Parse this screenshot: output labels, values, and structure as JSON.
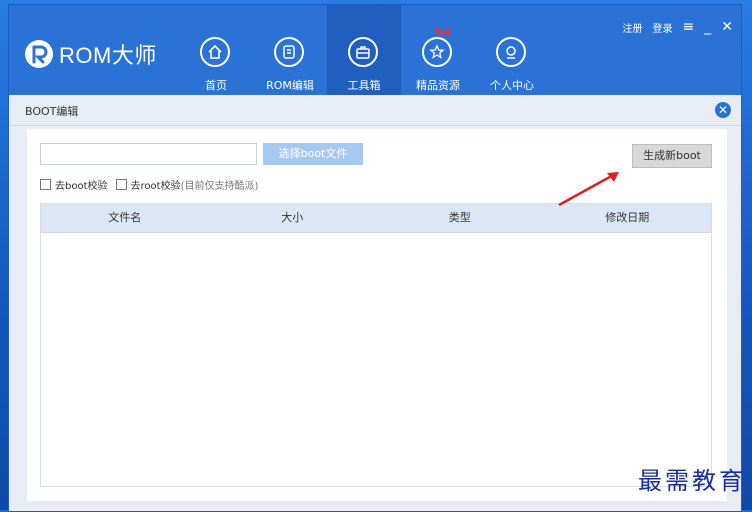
{
  "app": {
    "logo_text": "ROM大师"
  },
  "nav": [
    {
      "label": "首页",
      "icon": "home-icon"
    },
    {
      "label": "ROM编辑",
      "icon": "rom-edit-icon"
    },
    {
      "label": "工具箱",
      "icon": "toolbox-icon"
    },
    {
      "label": "精品资源",
      "icon": "star-icon",
      "badge": "hot"
    },
    {
      "label": "个人中心",
      "icon": "user-icon"
    }
  ],
  "window_controls": {
    "register": "注册",
    "login": "登录",
    "menu": "≡",
    "minimize": "_",
    "close": "✕"
  },
  "subbar": {
    "title": "BOOT编辑",
    "close": "✕"
  },
  "panel": {
    "path_value": "",
    "select_button": "选择boot文件",
    "generate_button": "生成新boot",
    "check_boot_label": "去boot校验",
    "check_root_label": "去root校验",
    "check_root_note": "(目前仅支持酷派)"
  },
  "table": {
    "columns": [
      "文件名",
      "大小",
      "类型",
      "修改日期"
    ],
    "rows": []
  },
  "watermark": "最需教育",
  "colors": {
    "titlebar": "#2b72d7",
    "active_nav": "#1f5fbf",
    "hot": "#ff2a2a",
    "arrow": "#e02020"
  }
}
